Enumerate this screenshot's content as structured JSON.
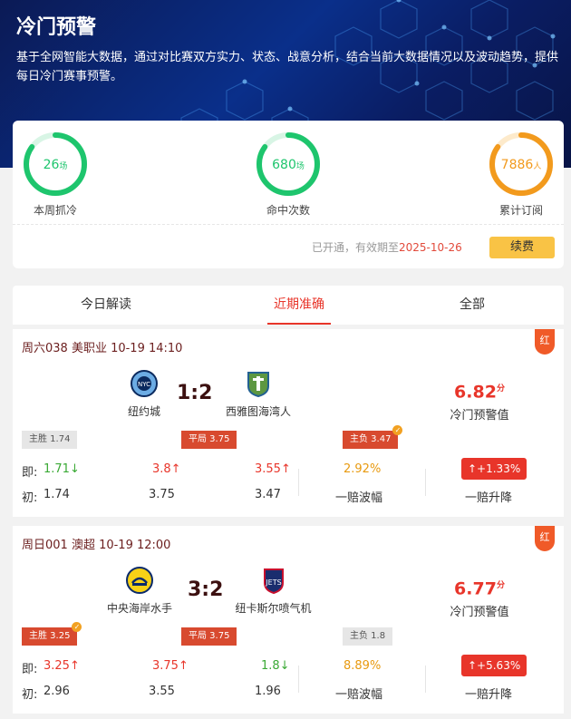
{
  "hero": {
    "title": "冷门预警",
    "description": "基于全网智能大数据，通过对比赛双方实力、状态、战意分析，结合当前大数据情况以及波动趋势，提供每日冷门赛事预警。"
  },
  "stats": [
    {
      "value": "26",
      "unit": "场",
      "label": "本周抓冷",
      "color": "#1ec56d",
      "progress": 0.85
    },
    {
      "value": "680",
      "unit": "场",
      "label": "命中次数",
      "color": "#1ec56d",
      "progress": 0.85
    },
    {
      "value": "7886",
      "unit": "人",
      "label": "累计订阅",
      "color": "#f29a1d",
      "progress": 0.85
    }
  ],
  "subscription": {
    "text": "已开通，有效期至",
    "date": "2025-10-26",
    "renew_label": "续费"
  },
  "tabs": [
    "今日解读",
    "近期准确",
    "全部"
  ],
  "matches": [
    {
      "header": "周六038 美职业 10-19 14:10",
      "tag": "红",
      "home": "纽约城",
      "away": "西雅图海湾人",
      "score": "1:2",
      "warning_value": "6.82",
      "warning_unit": "分",
      "warning_label": "冷门预警值",
      "badges": {
        "home": "主胜 1.74",
        "draw": "平局 3.75",
        "away": "主负 3.47"
      },
      "current_prefix": "即:",
      "initial_prefix": "初:",
      "current": [
        "1.71↓",
        "3.8↑",
        "3.55↑"
      ],
      "initial": [
        "1.74",
        "3.75",
        "3.47"
      ],
      "bounce": "2.92%",
      "bounce_label": "一赔波幅",
      "change": "↑+1.33%",
      "change_label": "一赔升降"
    },
    {
      "header": "周日001 澳超 10-19 12:00",
      "tag": "红",
      "home": "中央海岸水手",
      "away": "纽卡斯尔喷气机",
      "score": "3:2",
      "warning_value": "6.77",
      "warning_unit": "分",
      "warning_label": "冷门预警值",
      "badges": {
        "home": "主胜 3.25",
        "draw": "平局 3.75",
        "away": "主负 1.8"
      },
      "current_prefix": "即:",
      "initial_prefix": "初:",
      "current": [
        "3.25↑",
        "3.75↑",
        "1.8↓"
      ],
      "initial": [
        "2.96",
        "3.55",
        "1.96"
      ],
      "bounce": "8.89%",
      "bounce_label": "一赔波幅",
      "change": "↑+5.63%",
      "change_label": "一赔升降"
    }
  ]
}
